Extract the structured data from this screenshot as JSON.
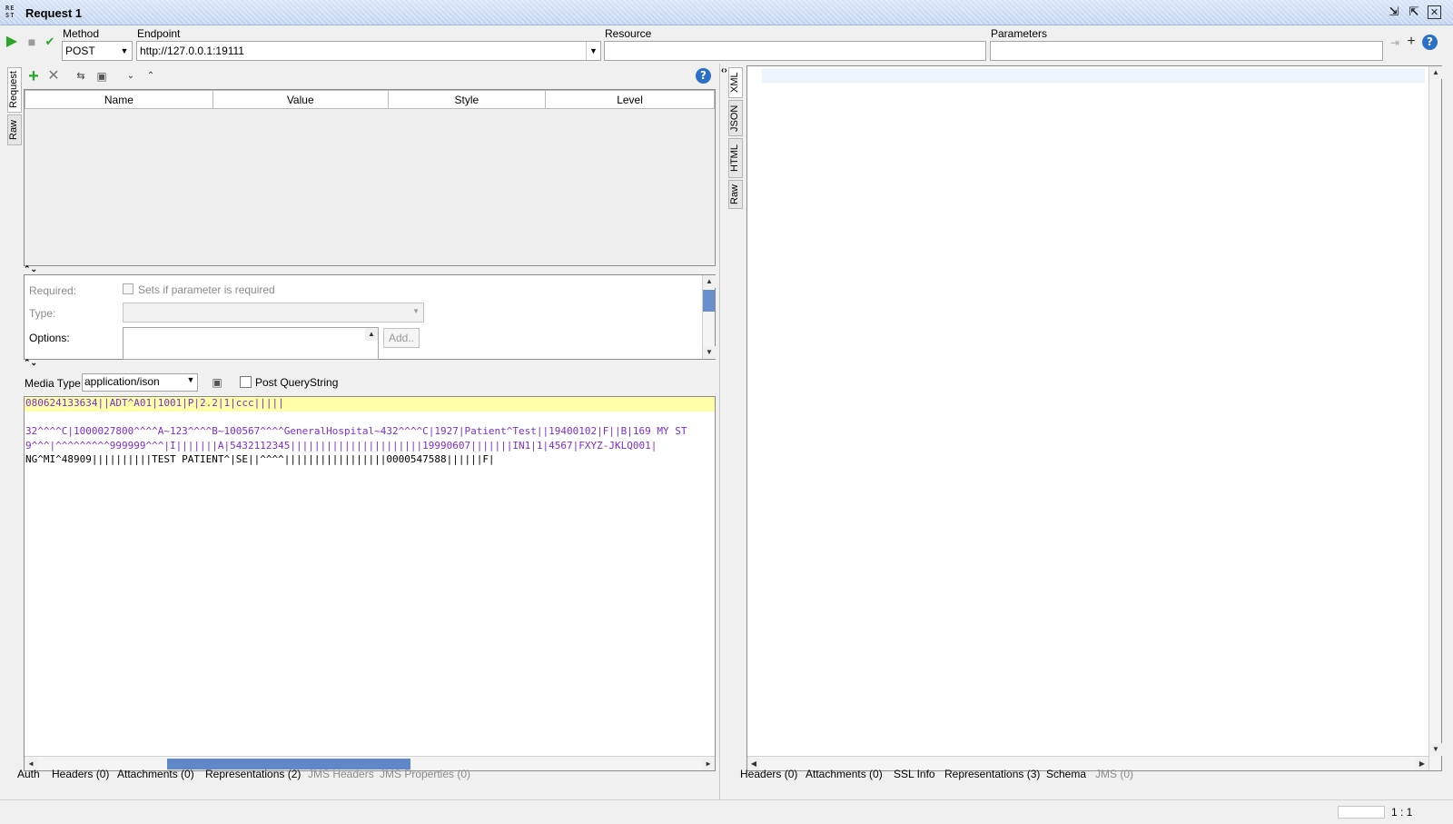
{
  "window": {
    "title": "Request 1",
    "logo_text": "RE ST"
  },
  "toolbar": {
    "method_label": "Method",
    "method_value": "POST",
    "endpoint_label": "Endpoint",
    "endpoint_value": "http://127.0.0.1:19111",
    "resource_label": "Resource",
    "resource_value": "",
    "parameters_label": "Parameters",
    "parameters_value": ""
  },
  "request_tabs": [
    "Request",
    "Raw"
  ],
  "params_table": {
    "columns": [
      "Name",
      "Value",
      "Style",
      "Level"
    ]
  },
  "param_details": {
    "required_label": "Required:",
    "required_checkbox_text": "Sets if parameter is required",
    "type_label": "Type:",
    "options_label": "Options:",
    "add_button": "Add.."
  },
  "media": {
    "label": "Media Type",
    "value": "application/ison",
    "post_querystring": "Post QueryString"
  },
  "body_lines": [
    {
      "text": "080624133634||ADT^A01|1001|P|2.2|1|ccc|||||",
      "highlight": true
    },
    {
      "text": "",
      "highlight": false
    },
    {
      "text": "32^^^^C|1000027800^^^^A~123^^^^B~100567^^^^GeneralHospital~432^^^^C|1927|Patient^Test||19400102|F||B|169 MY ST",
      "highlight": false
    },
    {
      "text": "9^^^|^^^^^^^^^999999^^^|I|||||||A|5432112345||||||||||||||||||||||19990607|||||||IN1|1|4567|FXYZ-JKLQ001|",
      "highlight": false
    },
    {
      "text": "NG^MI^48909||||||||||TEST PATIENT^|SE||^^^^|||||||||||||||||0000547588||||||F|",
      "highlight": false
    }
  ],
  "request_bottom_tabs": [
    "Auth",
    "Headers (0)",
    "Attachments (0)",
    "Representations (2)",
    "JMS Headers",
    "JMS Properties (0)"
  ],
  "response_tabs": [
    "XML",
    "JSON",
    "HTML",
    "Raw"
  ],
  "response_bottom_tabs": [
    "Headers (0)",
    "Attachments (0)",
    "SSL Info",
    "Representations (3)",
    "Schema",
    "JMS (0)"
  ],
  "status": {
    "position": "1 : 1"
  },
  "colors": {
    "accent_green": "#2aa52a",
    "title_bar": "#c7daf2",
    "highlight_line": "#ffffa8"
  }
}
